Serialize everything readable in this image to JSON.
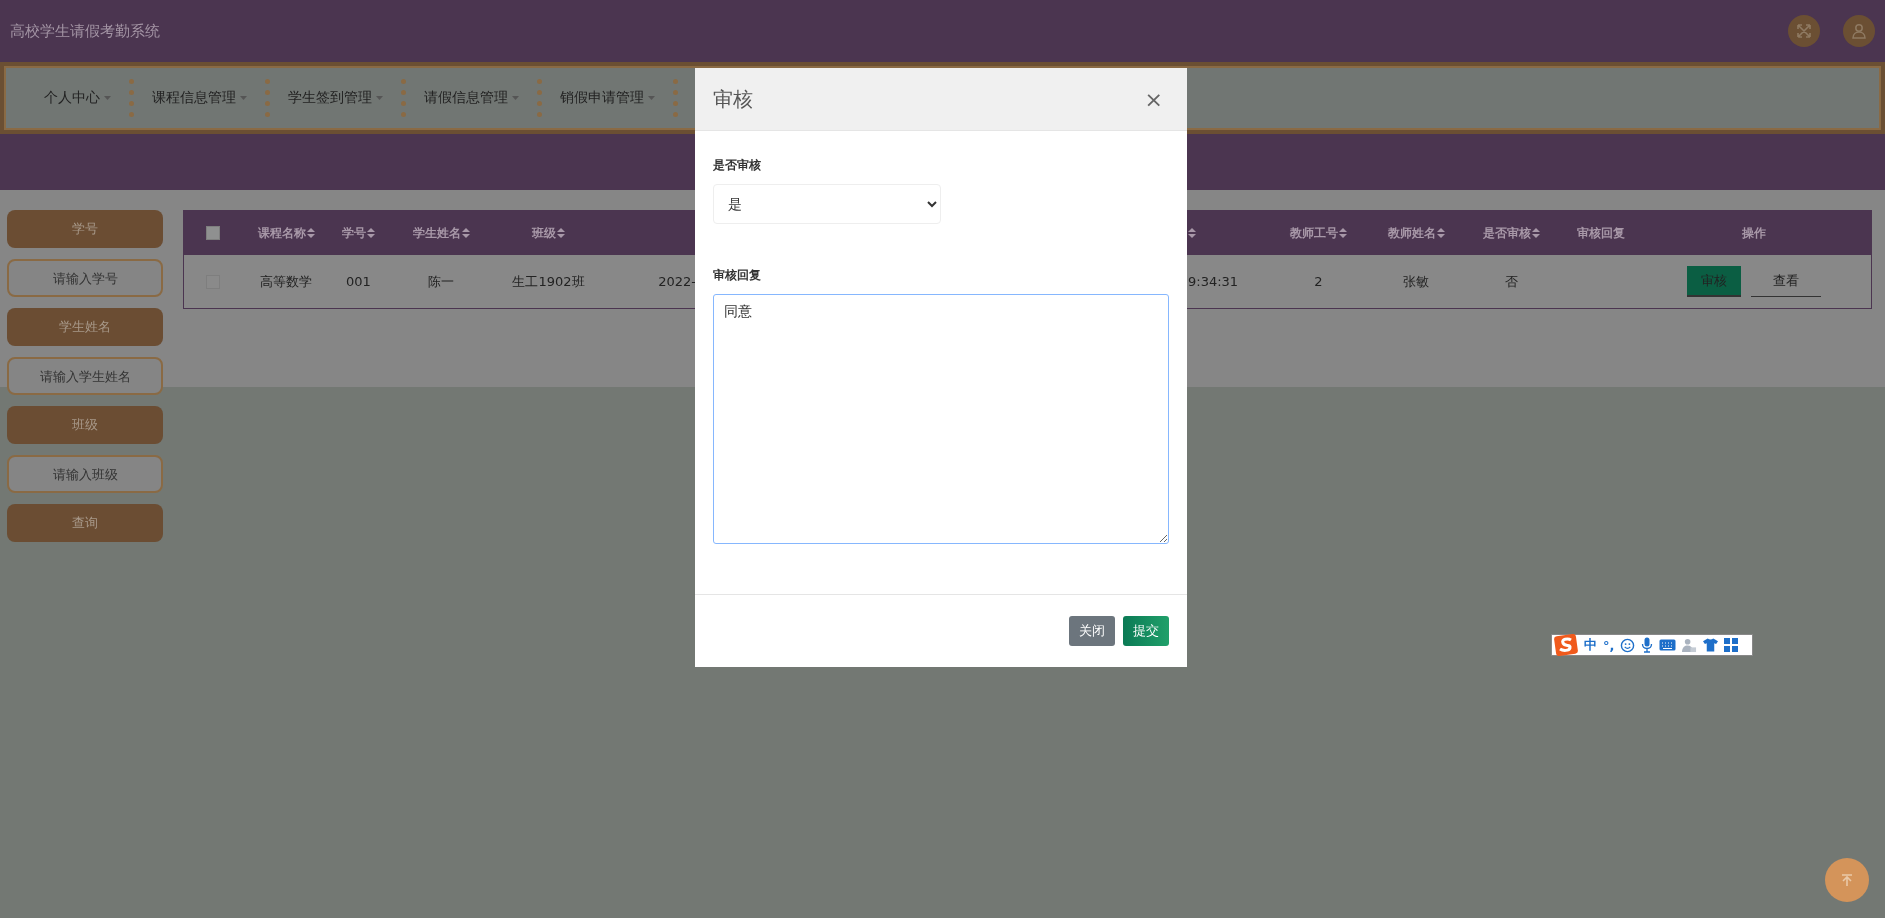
{
  "app": {
    "title": "高校学生请假考勤系统"
  },
  "nav": [
    {
      "label": "个人中心"
    },
    {
      "label": "课程信息管理"
    },
    {
      "label": "学生签到管理"
    },
    {
      "label": "请假信息管理"
    },
    {
      "label": "销假申请管理"
    }
  ],
  "filters": [
    {
      "kind": "label",
      "text": "学号"
    },
    {
      "kind": "input",
      "placeholder": "请输入学号"
    },
    {
      "kind": "label",
      "text": "学生姓名"
    },
    {
      "kind": "input",
      "placeholder": "请输入学生姓名"
    },
    {
      "kind": "label",
      "text": "班级"
    },
    {
      "kind": "input",
      "placeholder": "请输入班级"
    },
    {
      "kind": "button",
      "text": "查询"
    }
  ],
  "table": {
    "header_checked": false,
    "columns": [
      {
        "kind": "text",
        "label": "课程名称",
        "sortable": true
      },
      {
        "kind": "text",
        "label": "学号",
        "sortable": true
      },
      {
        "kind": "text",
        "label": "学生姓名",
        "sortable": true
      },
      {
        "kind": "text",
        "label": "班级",
        "sortable": true
      },
      {
        "kind": "cut_right"
      },
      {
        "kind": "cut_left",
        "sortable": true
      },
      {
        "kind": "text",
        "label": "教师工号",
        "sortable": true
      },
      {
        "kind": "text",
        "label": "教师姓名",
        "sortable": true
      },
      {
        "kind": "text",
        "label": "是否审核",
        "sortable": true
      },
      {
        "kind": "text",
        "label": "审核回复",
        "sortable": false
      },
      {
        "kind": "actions",
        "label": "操作",
        "sortable": false
      }
    ],
    "rows": [
      {
        "checked": false,
        "cells": [
          "高等数学",
          "001",
          "陈一",
          "生工1902班",
          "2022-",
          "9:34:31",
          "2",
          "张敏",
          "否",
          null
        ],
        "actions": [
          {
            "kind": "primary",
            "label": "审核"
          },
          {
            "kind": "link",
            "label": "查看"
          }
        ]
      }
    ]
  },
  "modal": {
    "title": "审核",
    "close": "×",
    "fields": [
      {
        "kind": "select",
        "label": "是否审核",
        "value": "是"
      },
      {
        "kind": "textarea",
        "label": "审核回复",
        "value": "同意"
      }
    ],
    "buttons": [
      {
        "kind": "secondary",
        "label": "关闭"
      },
      {
        "kind": "primary",
        "label": "提交"
      }
    ]
  },
  "ime_toolbar": {
    "mode": "中",
    "punct": "°,"
  }
}
